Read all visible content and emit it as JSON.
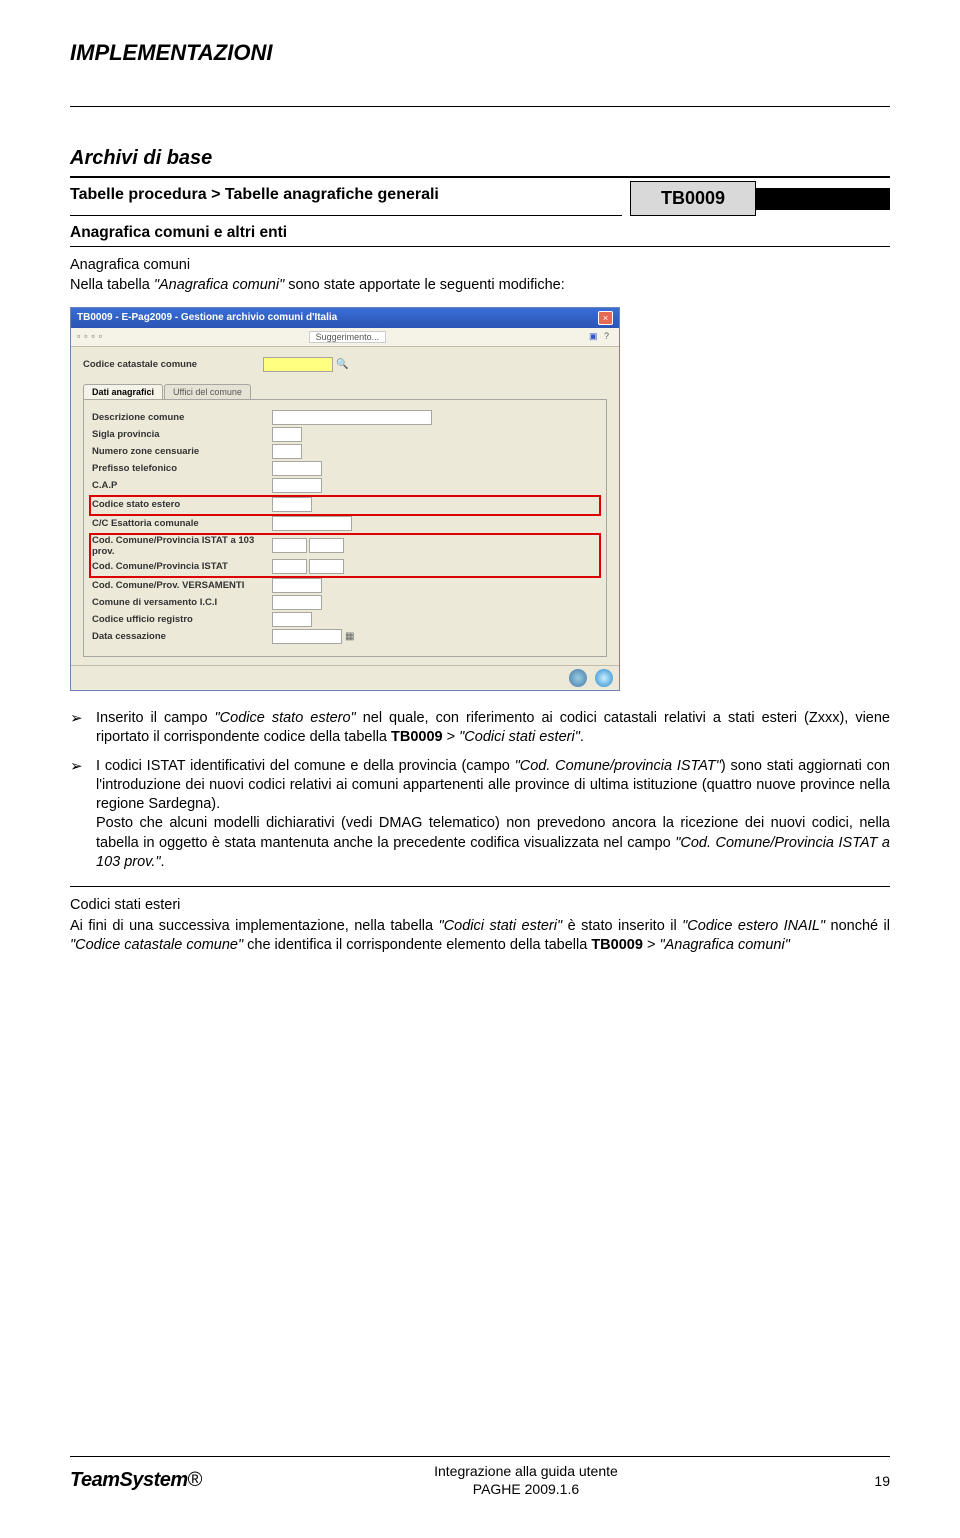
{
  "header": {
    "title": "IMPLEMENTAZIONI"
  },
  "section": {
    "title": "Archivi di base",
    "breadcrumb": "Tabelle procedura > Tabelle anagrafiche generali",
    "code": "TB0009",
    "subsection": "Anagrafica comuni e altri enti"
  },
  "block1": {
    "heading": "Anagrafica comuni",
    "intro_prefix": "Nella tabella ",
    "intro_quoted": "\"Anagrafica comuni\"",
    "intro_suffix": " sono state apportate le seguenti modifiche:"
  },
  "screenshot": {
    "title": "TB0009 - E-Pag2009 - Gestione archivio comuni d'Italia",
    "tool_text": "Suggerimento...",
    "field_cod_catastale": "Codice catastale comune",
    "tab1": "Dati anagrafici",
    "tab2": "Uffici del comune",
    "rows": {
      "desc": "Descrizione comune",
      "sigla": "Sigla provincia",
      "zone": "Numero zone censuarie",
      "prefisso": "Prefisso telefonico",
      "cap": "C.A.P",
      "stato_estero": "Codice stato estero",
      "esattoria": "C/C Esattoria comunale",
      "istat103": "Cod. Comune/Provincia ISTAT a 103 prov.",
      "istat": "Cod. Comune/Provincia ISTAT",
      "versamenti": "Cod. Comune/Prov. VERSAMENTI",
      "comune_vers": "Comune di versamento I.C.I",
      "ufficio_reg": "Codice ufficio registro",
      "data_cess": "Data cessazione"
    }
  },
  "bullet1": {
    "t1": "Inserito il campo ",
    "q1": "\"Codice stato estero\"",
    "t2": " nel quale, con riferimento ai codici catastali relativi a stati esteri (Zxxx), viene riportato il corrispondente codice della tabella ",
    "b1": "TB0009",
    "t3": " > ",
    "q2": "\"Codici stati esteri\"",
    "t4": "."
  },
  "bullet2": {
    "t1": "I codici ISTAT identificativi del comune e della provincia (campo ",
    "q1": "\"Cod. Comune/provincia ISTAT\"",
    "t2": ") sono stati aggiornati con l'introduzione dei nuovi codici relativi ai comuni appartenenti alle province di ultima istituzione (quattro nuove province nella regione Sardegna).",
    "p2": "Posto che alcuni modelli dichiarativi (vedi DMAG telematico) non prevedono ancora la ricezione dei nuovi codici, nella tabella in oggetto è stata mantenuta anche la precedente codifica visualizzata nel campo ",
    "q2": "\"Cod. Comune/Provincia ISTAT a 103 prov.\"",
    "p3": "."
  },
  "block2": {
    "heading": "Codici stati esteri",
    "t1": "Ai fini di una successiva implementazione, nella tabella ",
    "q1": "\"Codici stati esteri\"",
    "t2": " è stato inserito il ",
    "q2": "\"Codice estero INAIL\"",
    "t3": " nonché il ",
    "q3": "\"Codice catastale comune\"",
    "t4": " che identifica il corrispondente elemento della tabella ",
    "b1": "TB0009",
    "t5": " > ",
    "q4": "\"Anagrafica comuni\""
  },
  "footer": {
    "logo": "TeamSystem",
    "line1": "Integrazione alla guida utente",
    "line2": "PAGHE 2009.1.6",
    "page": "19"
  }
}
